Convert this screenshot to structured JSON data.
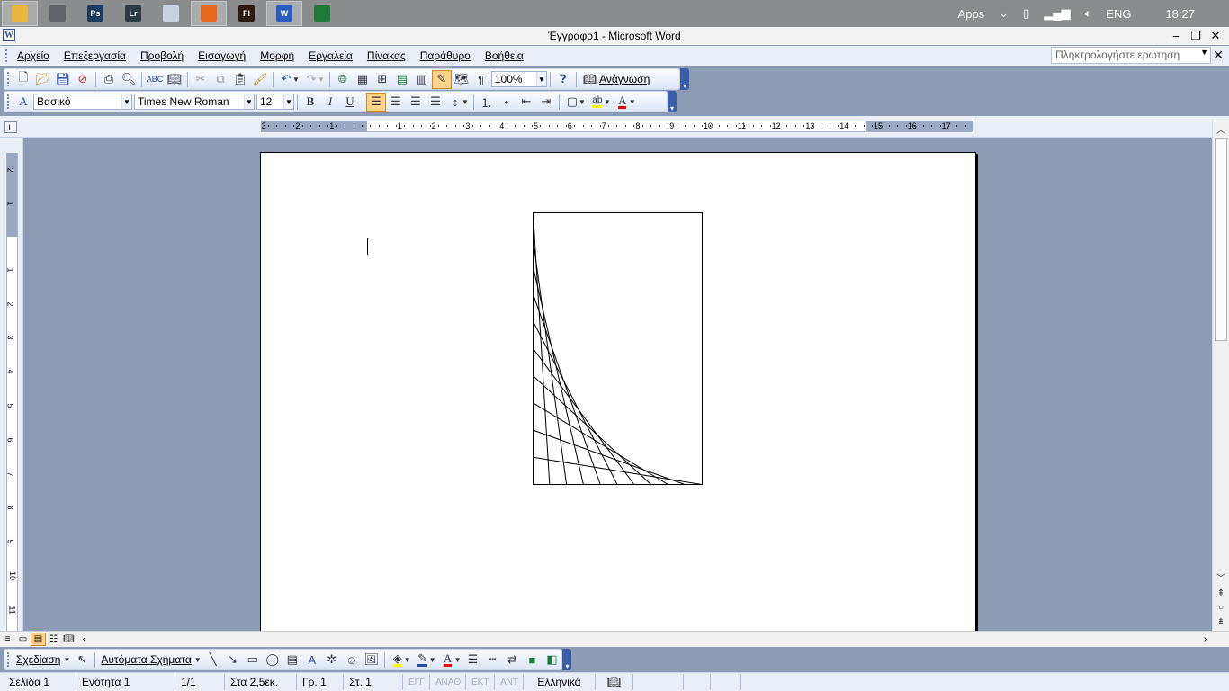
{
  "taskbar": {
    "apps": [
      {
        "name": "file-explorer",
        "label": "",
        "color": "#e8b73c",
        "active": true
      },
      {
        "name": "system-app",
        "label": "",
        "color": "#606468",
        "active": false
      },
      {
        "name": "photoshop",
        "label": "Ps",
        "color": "#1d3b5a",
        "active": false
      },
      {
        "name": "lightroom",
        "label": "Lr",
        "color": "#2c3a44",
        "active": false
      },
      {
        "name": "calculator",
        "label": "",
        "color": "#c9d3e0",
        "active": false
      },
      {
        "name": "firefox",
        "label": "",
        "color": "#e66a1c",
        "active": true
      },
      {
        "name": "flash",
        "label": "Fl",
        "color": "#2a1a10",
        "active": false
      },
      {
        "name": "word",
        "label": "W",
        "color": "#2b5bbf",
        "active": true
      },
      {
        "name": "excel",
        "label": "",
        "color": "#1f7a3a",
        "active": false
      }
    ],
    "apps_label": "Apps",
    "language": "ENG",
    "time": "18:27"
  },
  "window": {
    "title": "Έγγραφο1 - Microsoft Word"
  },
  "menu": {
    "items": [
      "Αρχείο",
      "Επεξεργασία",
      "Προβολή",
      "Εισαγωγή",
      "Μορφή",
      "Εργαλεία",
      "Πίνακας",
      "Παράθυρο",
      "Βοήθεια"
    ],
    "ask_placeholder": "Πληκτρολογήστε ερώτηση"
  },
  "standard_toolbar": {
    "zoom": "100%",
    "read_label": "Ανάγνωση"
  },
  "formatting_toolbar": {
    "style": "Βασικό",
    "font": "Times New Roman",
    "size": "12",
    "bold": "B",
    "italic": "I",
    "underline": "U",
    "highlight_color": "#ffff00",
    "font_color": "#ff0000"
  },
  "ruler": {
    "horizontal_numbers": [
      "3",
      "2",
      "1",
      "1",
      "2",
      "3",
      "4",
      "5",
      "6",
      "7",
      "8",
      "9",
      "10",
      "11",
      "12",
      "13",
      "14",
      "15",
      "16",
      "17"
    ],
    "vertical_numbers": [
      "2",
      "1",
      "1",
      "2",
      "3",
      "4",
      "5",
      "6",
      "7",
      "8",
      "9",
      "10",
      "11"
    ]
  },
  "drawing_toolbar": {
    "draw_label": "Σχεδίαση",
    "autoshapes_label": "Αυτόματα Σχήματα"
  },
  "status": {
    "page": "Σελίδα 1",
    "section": "Ενότητα 1",
    "pages": "1/1",
    "at": "Στα 2,5εκ.",
    "line": "Γρ. 1",
    "column": "Στ. 1",
    "rec": "ΕΓΓ",
    "trk": "ΑΝΑΘ",
    "ext": "ΕΚΤ",
    "ovr": "ΑΝΤ",
    "language": "Ελληνικά"
  }
}
